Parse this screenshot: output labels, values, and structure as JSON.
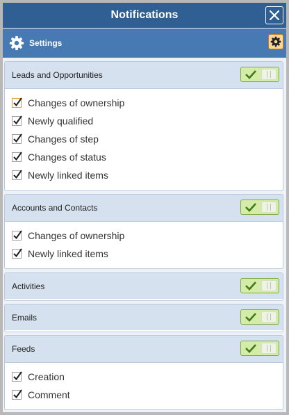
{
  "window": {
    "title": "Notifications"
  },
  "toolbar": {
    "settings_label": "Settings"
  },
  "colors": {
    "titlebar": "#2f5f93",
    "toolbar": "#477ab2",
    "panel_header": "#d5e1ee",
    "toggle_on": "#d4eca8",
    "check": "#1d1d1d",
    "toggle_check": "#3f7a1a"
  },
  "panels": [
    {
      "title": "Leads and Opportunities",
      "enabled": true,
      "items": [
        {
          "label": "Changes of ownership",
          "checked": true
        },
        {
          "label": "Newly qualified",
          "checked": true
        },
        {
          "label": "Changes of step",
          "checked": true
        },
        {
          "label": "Changes of status",
          "checked": true
        },
        {
          "label": "Newly linked items",
          "checked": true
        }
      ]
    },
    {
      "title": "Accounts and Contacts",
      "enabled": true,
      "items": [
        {
          "label": "Changes of ownership",
          "checked": true
        },
        {
          "label": "Newly linked items",
          "checked": true
        }
      ]
    },
    {
      "title": "Activities",
      "enabled": true,
      "items": []
    },
    {
      "title": "Emails",
      "enabled": true,
      "items": []
    },
    {
      "title": "Feeds",
      "enabled": true,
      "items": [
        {
          "label": "Creation",
          "checked": true
        },
        {
          "label": "Comment",
          "checked": true
        }
      ]
    }
  ]
}
